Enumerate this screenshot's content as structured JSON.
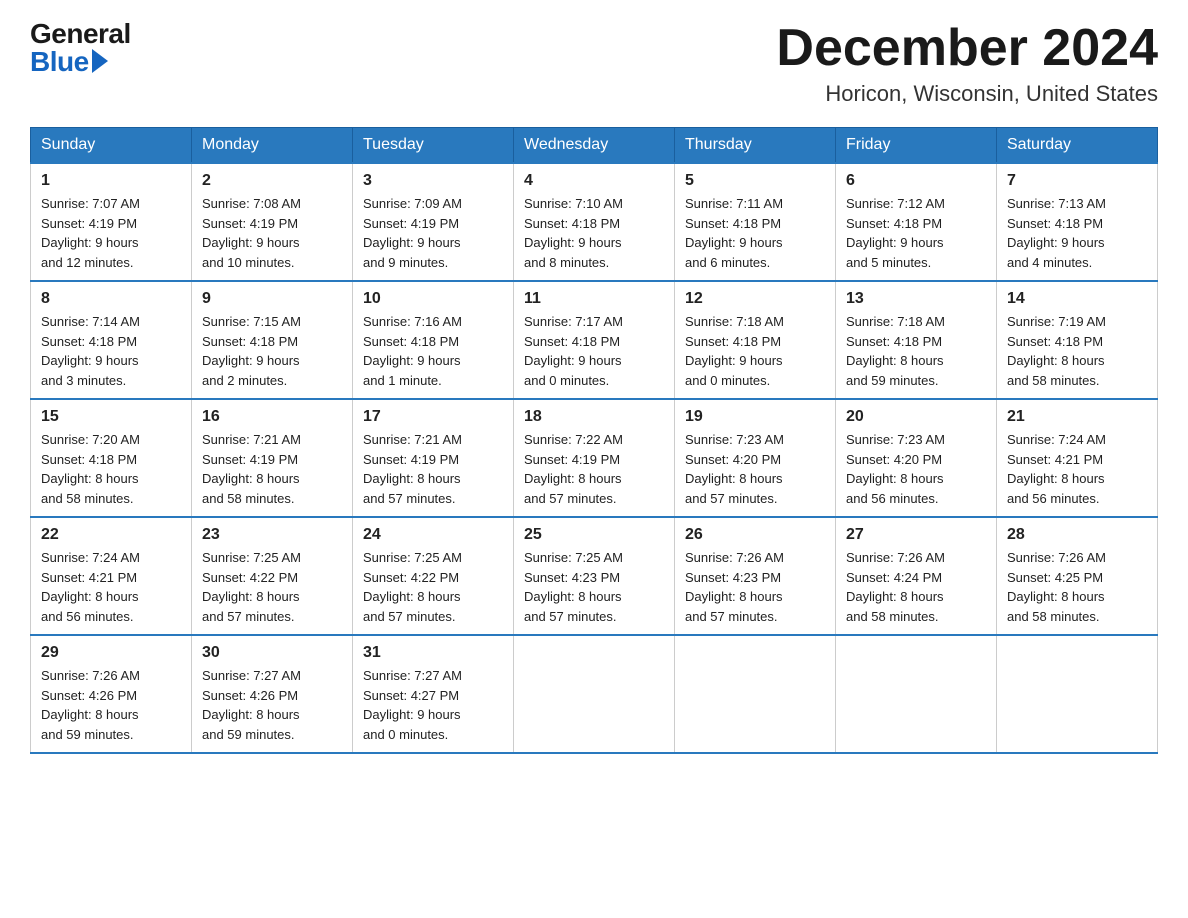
{
  "header": {
    "logo_general": "General",
    "logo_blue": "Blue",
    "month_year": "December 2024",
    "location": "Horicon, Wisconsin, United States"
  },
  "columns": [
    "Sunday",
    "Monday",
    "Tuesday",
    "Wednesday",
    "Thursday",
    "Friday",
    "Saturday"
  ],
  "weeks": [
    [
      {
        "day": "1",
        "sunrise": "Sunrise: 7:07 AM",
        "sunset": "Sunset: 4:19 PM",
        "daylight": "Daylight: 9 hours",
        "daylight2": "and 12 minutes."
      },
      {
        "day": "2",
        "sunrise": "Sunrise: 7:08 AM",
        "sunset": "Sunset: 4:19 PM",
        "daylight": "Daylight: 9 hours",
        "daylight2": "and 10 minutes."
      },
      {
        "day": "3",
        "sunrise": "Sunrise: 7:09 AM",
        "sunset": "Sunset: 4:19 PM",
        "daylight": "Daylight: 9 hours",
        "daylight2": "and 9 minutes."
      },
      {
        "day": "4",
        "sunrise": "Sunrise: 7:10 AM",
        "sunset": "Sunset: 4:18 PM",
        "daylight": "Daylight: 9 hours",
        "daylight2": "and 8 minutes."
      },
      {
        "day": "5",
        "sunrise": "Sunrise: 7:11 AM",
        "sunset": "Sunset: 4:18 PM",
        "daylight": "Daylight: 9 hours",
        "daylight2": "and 6 minutes."
      },
      {
        "day": "6",
        "sunrise": "Sunrise: 7:12 AM",
        "sunset": "Sunset: 4:18 PM",
        "daylight": "Daylight: 9 hours",
        "daylight2": "and 5 minutes."
      },
      {
        "day": "7",
        "sunrise": "Sunrise: 7:13 AM",
        "sunset": "Sunset: 4:18 PM",
        "daylight": "Daylight: 9 hours",
        "daylight2": "and 4 minutes."
      }
    ],
    [
      {
        "day": "8",
        "sunrise": "Sunrise: 7:14 AM",
        "sunset": "Sunset: 4:18 PM",
        "daylight": "Daylight: 9 hours",
        "daylight2": "and 3 minutes."
      },
      {
        "day": "9",
        "sunrise": "Sunrise: 7:15 AM",
        "sunset": "Sunset: 4:18 PM",
        "daylight": "Daylight: 9 hours",
        "daylight2": "and 2 minutes."
      },
      {
        "day": "10",
        "sunrise": "Sunrise: 7:16 AM",
        "sunset": "Sunset: 4:18 PM",
        "daylight": "Daylight: 9 hours",
        "daylight2": "and 1 minute."
      },
      {
        "day": "11",
        "sunrise": "Sunrise: 7:17 AM",
        "sunset": "Sunset: 4:18 PM",
        "daylight": "Daylight: 9 hours",
        "daylight2": "and 0 minutes."
      },
      {
        "day": "12",
        "sunrise": "Sunrise: 7:18 AM",
        "sunset": "Sunset: 4:18 PM",
        "daylight": "Daylight: 9 hours",
        "daylight2": "and 0 minutes."
      },
      {
        "day": "13",
        "sunrise": "Sunrise: 7:18 AM",
        "sunset": "Sunset: 4:18 PM",
        "daylight": "Daylight: 8 hours",
        "daylight2": "and 59 minutes."
      },
      {
        "day": "14",
        "sunrise": "Sunrise: 7:19 AM",
        "sunset": "Sunset: 4:18 PM",
        "daylight": "Daylight: 8 hours",
        "daylight2": "and 58 minutes."
      }
    ],
    [
      {
        "day": "15",
        "sunrise": "Sunrise: 7:20 AM",
        "sunset": "Sunset: 4:18 PM",
        "daylight": "Daylight: 8 hours",
        "daylight2": "and 58 minutes."
      },
      {
        "day": "16",
        "sunrise": "Sunrise: 7:21 AM",
        "sunset": "Sunset: 4:19 PM",
        "daylight": "Daylight: 8 hours",
        "daylight2": "and 58 minutes."
      },
      {
        "day": "17",
        "sunrise": "Sunrise: 7:21 AM",
        "sunset": "Sunset: 4:19 PM",
        "daylight": "Daylight: 8 hours",
        "daylight2": "and 57 minutes."
      },
      {
        "day": "18",
        "sunrise": "Sunrise: 7:22 AM",
        "sunset": "Sunset: 4:19 PM",
        "daylight": "Daylight: 8 hours",
        "daylight2": "and 57 minutes."
      },
      {
        "day": "19",
        "sunrise": "Sunrise: 7:23 AM",
        "sunset": "Sunset: 4:20 PM",
        "daylight": "Daylight: 8 hours",
        "daylight2": "and 57 minutes."
      },
      {
        "day": "20",
        "sunrise": "Sunrise: 7:23 AM",
        "sunset": "Sunset: 4:20 PM",
        "daylight": "Daylight: 8 hours",
        "daylight2": "and 56 minutes."
      },
      {
        "day": "21",
        "sunrise": "Sunrise: 7:24 AM",
        "sunset": "Sunset: 4:21 PM",
        "daylight": "Daylight: 8 hours",
        "daylight2": "and 56 minutes."
      }
    ],
    [
      {
        "day": "22",
        "sunrise": "Sunrise: 7:24 AM",
        "sunset": "Sunset: 4:21 PM",
        "daylight": "Daylight: 8 hours",
        "daylight2": "and 56 minutes."
      },
      {
        "day": "23",
        "sunrise": "Sunrise: 7:25 AM",
        "sunset": "Sunset: 4:22 PM",
        "daylight": "Daylight: 8 hours",
        "daylight2": "and 57 minutes."
      },
      {
        "day": "24",
        "sunrise": "Sunrise: 7:25 AM",
        "sunset": "Sunset: 4:22 PM",
        "daylight": "Daylight: 8 hours",
        "daylight2": "and 57 minutes."
      },
      {
        "day": "25",
        "sunrise": "Sunrise: 7:25 AM",
        "sunset": "Sunset: 4:23 PM",
        "daylight": "Daylight: 8 hours",
        "daylight2": "and 57 minutes."
      },
      {
        "day": "26",
        "sunrise": "Sunrise: 7:26 AM",
        "sunset": "Sunset: 4:23 PM",
        "daylight": "Daylight: 8 hours",
        "daylight2": "and 57 minutes."
      },
      {
        "day": "27",
        "sunrise": "Sunrise: 7:26 AM",
        "sunset": "Sunset: 4:24 PM",
        "daylight": "Daylight: 8 hours",
        "daylight2": "and 58 minutes."
      },
      {
        "day": "28",
        "sunrise": "Sunrise: 7:26 AM",
        "sunset": "Sunset: 4:25 PM",
        "daylight": "Daylight: 8 hours",
        "daylight2": "and 58 minutes."
      }
    ],
    [
      {
        "day": "29",
        "sunrise": "Sunrise: 7:26 AM",
        "sunset": "Sunset: 4:26 PM",
        "daylight": "Daylight: 8 hours",
        "daylight2": "and 59 minutes."
      },
      {
        "day": "30",
        "sunrise": "Sunrise: 7:27 AM",
        "sunset": "Sunset: 4:26 PM",
        "daylight": "Daylight: 8 hours",
        "daylight2": "and 59 minutes."
      },
      {
        "day": "31",
        "sunrise": "Sunrise: 7:27 AM",
        "sunset": "Sunset: 4:27 PM",
        "daylight": "Daylight: 9 hours",
        "daylight2": "and 0 minutes."
      },
      null,
      null,
      null,
      null
    ]
  ]
}
